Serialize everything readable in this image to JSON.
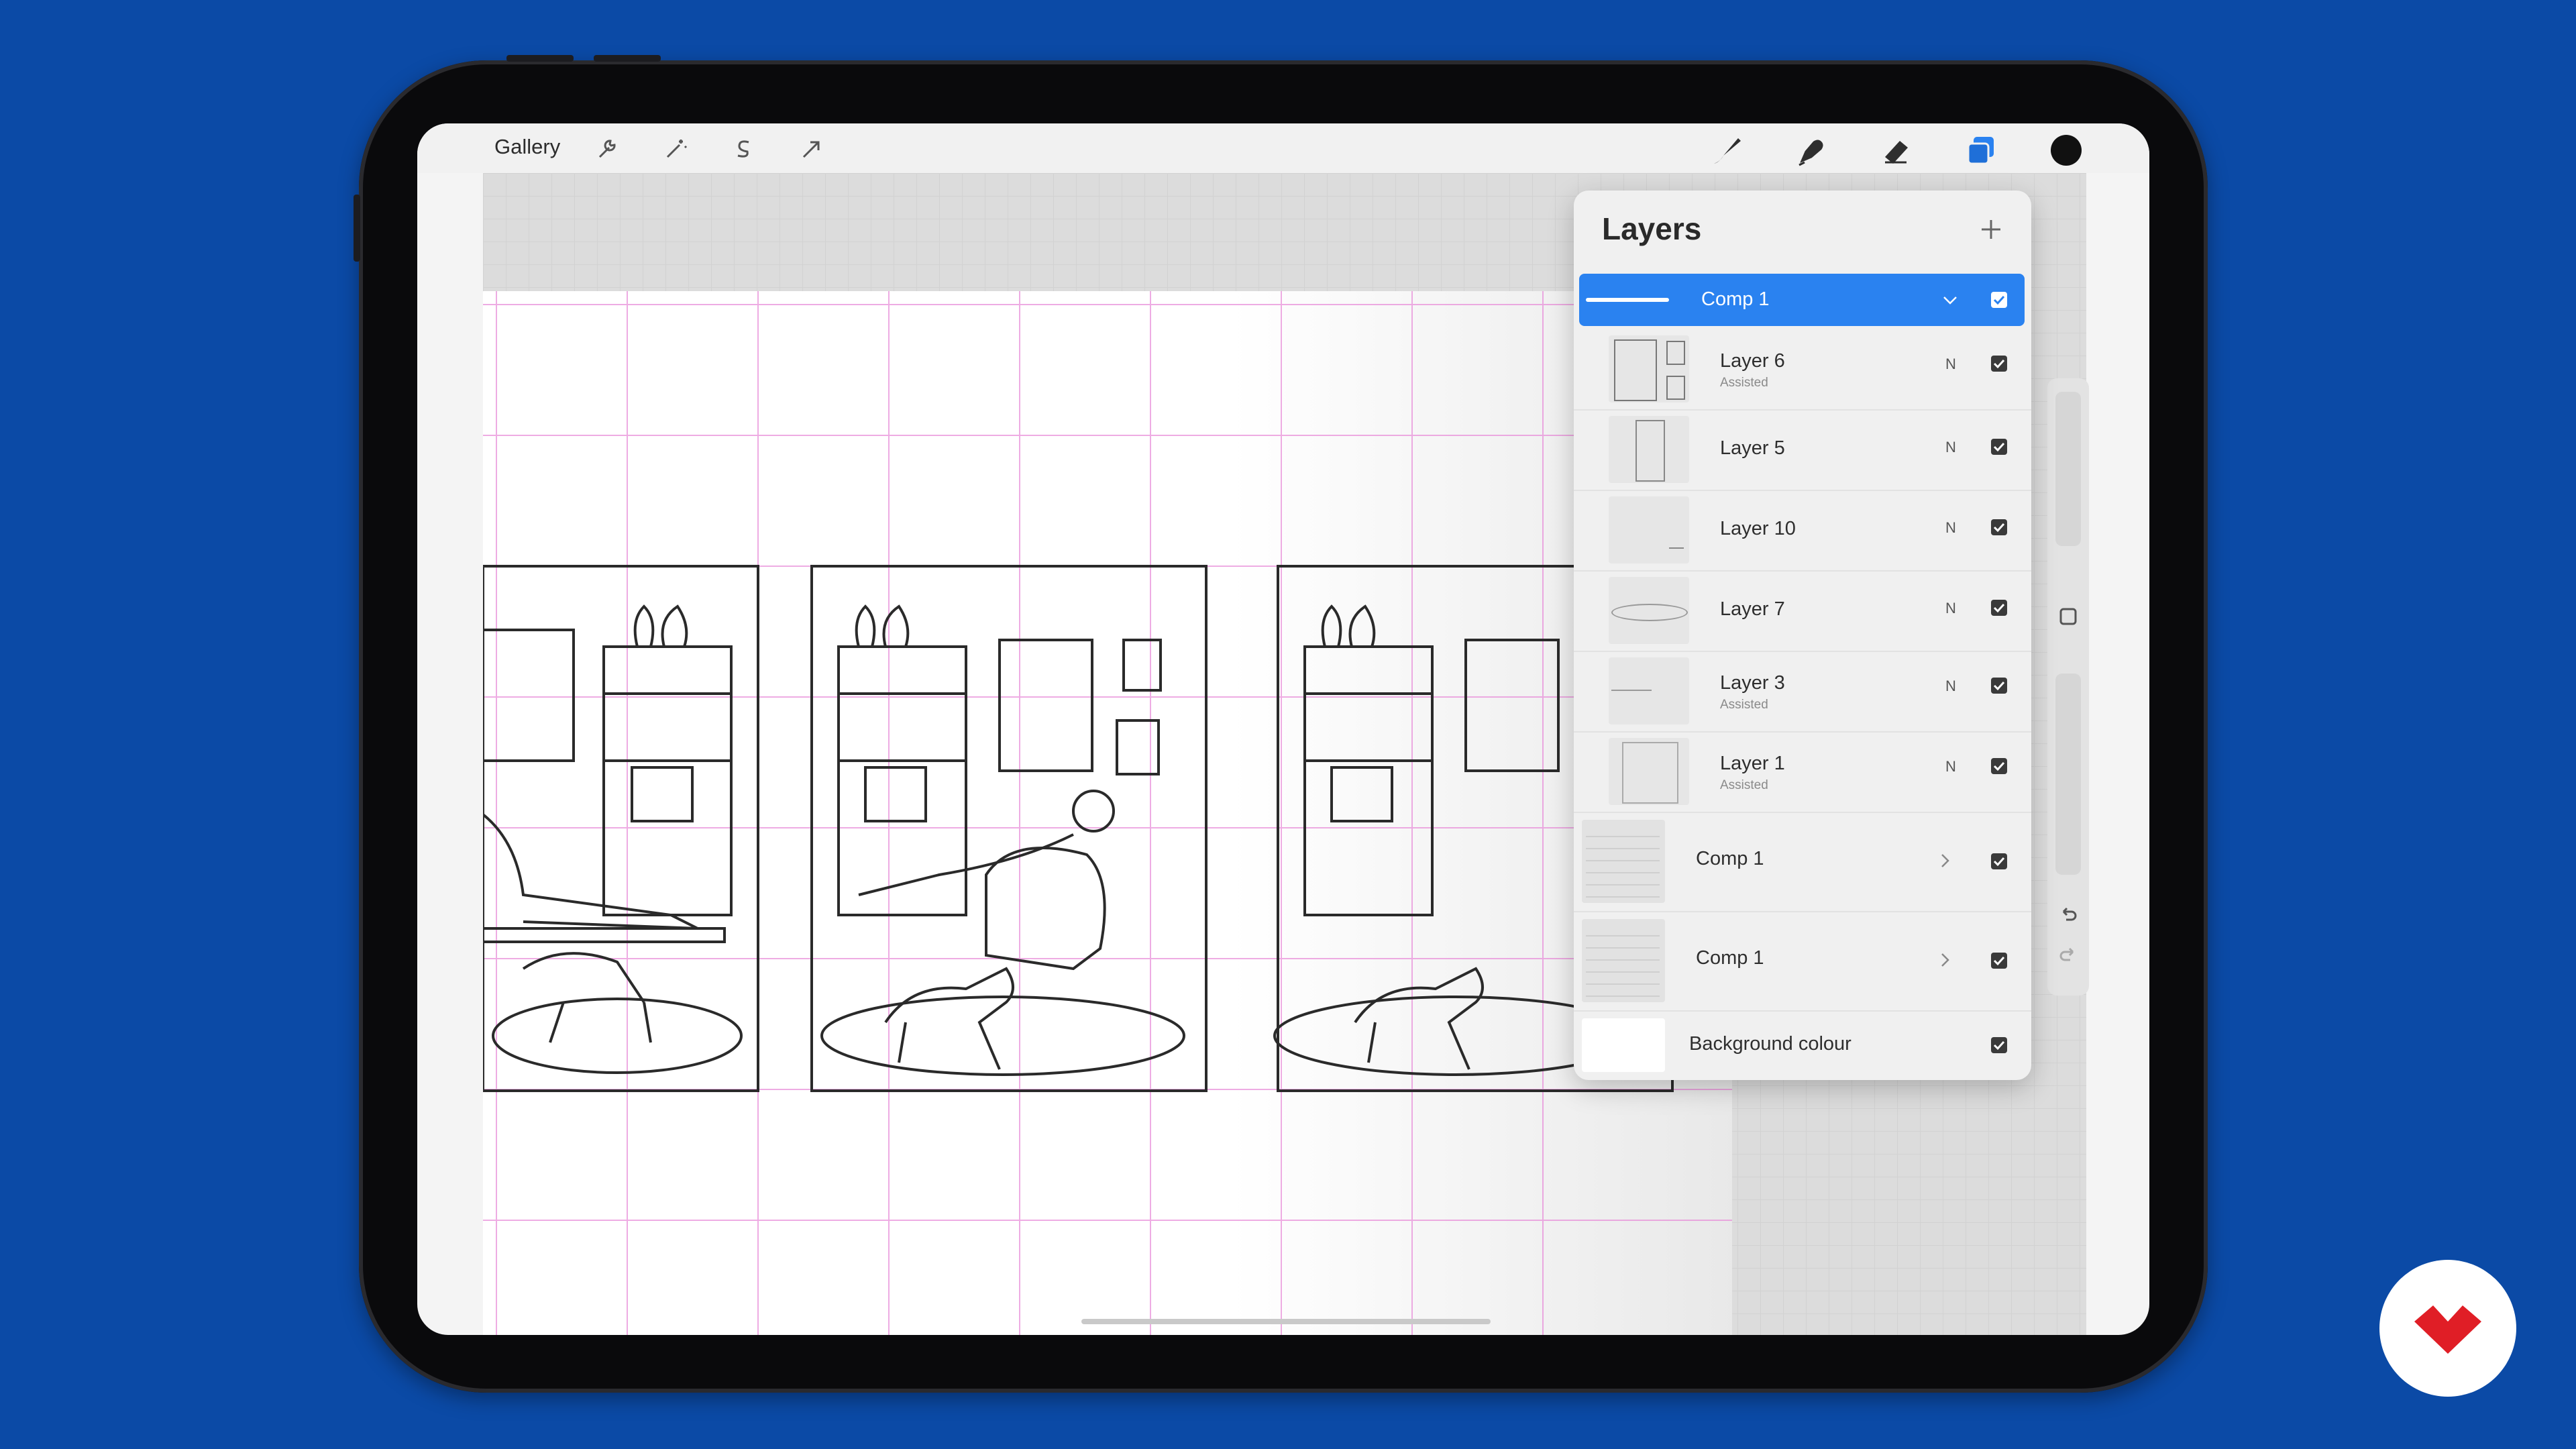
{
  "topbar": {
    "gallery_label": "Gallery",
    "left_tools": [
      "wrench-icon",
      "magic-wand-icon",
      "selection-s-icon",
      "transform-arrow-icon"
    ],
    "right_tools": [
      "brush-icon",
      "smudge-icon",
      "eraser-icon",
      "layers-icon",
      "color-swatch"
    ],
    "accent_color": "#2a82f0",
    "swatch_color": "#111111"
  },
  "layers_panel": {
    "title": "Layers",
    "add_icon": "plus-icon",
    "rows": [
      {
        "name": "Comp 1",
        "type": "group-active",
        "expanded": true,
        "visible": true
      },
      {
        "name": "Layer 6",
        "subtitle": "Assisted",
        "blend": "N",
        "visible": true
      },
      {
        "name": "Layer 5",
        "subtitle": "",
        "blend": "N",
        "visible": true
      },
      {
        "name": "Layer 10",
        "subtitle": "",
        "blend": "N",
        "visible": true
      },
      {
        "name": "Layer 7",
        "subtitle": "",
        "blend": "N",
        "visible": true
      },
      {
        "name": "Layer 3",
        "subtitle": "Assisted",
        "blend": "N",
        "visible": true
      },
      {
        "name": "Layer 1",
        "subtitle": "Assisted",
        "blend": "N",
        "visible": true
      },
      {
        "name": "Comp 1",
        "type": "group",
        "expanded": false,
        "visible": true
      },
      {
        "name": "Comp 1",
        "type": "group",
        "expanded": false,
        "visible": true
      },
      {
        "name": "Background colour",
        "type": "background",
        "visible": true
      }
    ]
  },
  "sidebar": {
    "tools": [
      "modify-button-icon",
      "undo-icon",
      "redo-icon"
    ]
  },
  "brand": {
    "logo_color": "#e01e26"
  }
}
